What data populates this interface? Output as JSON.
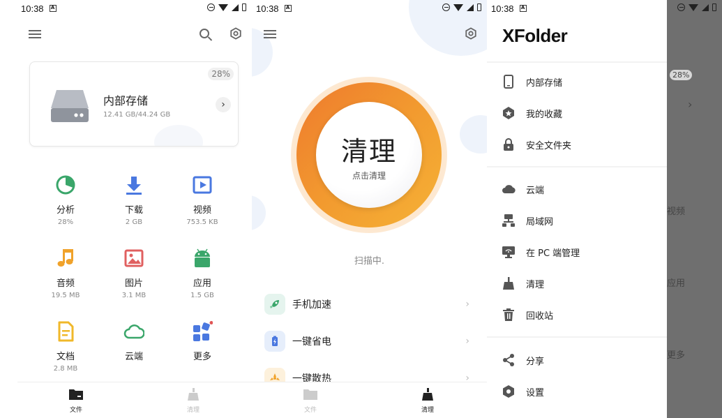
{
  "status": {
    "time": "10:38"
  },
  "files": {
    "storage": {
      "title": "内部存储",
      "usage": "12.41 GB/44.24 GB",
      "percent": "28%",
      "percent_value": 28
    },
    "categories": [
      {
        "label": "分析",
        "value": "28%",
        "icon": "pie-chart-icon",
        "color": "#3aa66a"
      },
      {
        "label": "下载",
        "value": "2 GB",
        "icon": "download-icon",
        "color": "#4a78e0"
      },
      {
        "label": "视频",
        "value": "753.5 KB",
        "icon": "video-icon",
        "color": "#4a78e0"
      },
      {
        "label": "音频",
        "value": "19.5 MB",
        "icon": "music-icon",
        "color": "#f0a22a"
      },
      {
        "label": "图片",
        "value": "3.1 MB",
        "icon": "image-icon",
        "color": "#e06060"
      },
      {
        "label": "应用",
        "value": "1.5 GB",
        "icon": "android-icon",
        "color": "#3aa66a"
      },
      {
        "label": "文档",
        "value": "2.8 MB",
        "icon": "document-icon",
        "color": "#f0b82a"
      },
      {
        "label": "云端",
        "value": "",
        "icon": "cloud-icon",
        "color": "#3aa66a"
      },
      {
        "label": "更多",
        "value": "",
        "icon": "more-apps-icon",
        "color": "#4a78e0"
      }
    ]
  },
  "tabs": {
    "files": "文件",
    "clean": "清理"
  },
  "cleaner": {
    "big": "清理",
    "small": "点击清理",
    "scanning": "扫描中.",
    "tools": [
      {
        "label": "手机加速",
        "icon": "rocket-icon"
      },
      {
        "label": "一键省电",
        "icon": "battery-icon"
      },
      {
        "label": "一键散热",
        "icon": "fan-icon"
      }
    ]
  },
  "drawer": {
    "app_name": "XFolder",
    "group1": [
      {
        "label": "内部存储",
        "icon": "phone-icon"
      },
      {
        "label": "我的收藏",
        "icon": "star-icon"
      },
      {
        "label": "安全文件夹",
        "icon": "lock-icon"
      }
    ],
    "group2": [
      {
        "label": "云端",
        "icon": "cloud-icon"
      },
      {
        "label": "局域网",
        "icon": "lan-icon"
      },
      {
        "label": "在 PC 端管理",
        "icon": "pc-icon"
      },
      {
        "label": "清理",
        "icon": "broom-icon"
      },
      {
        "label": "回收站",
        "icon": "trash-icon"
      }
    ],
    "group3": [
      {
        "label": "分享",
        "icon": "share-icon"
      },
      {
        "label": "设置",
        "icon": "settings-icon"
      }
    ]
  }
}
